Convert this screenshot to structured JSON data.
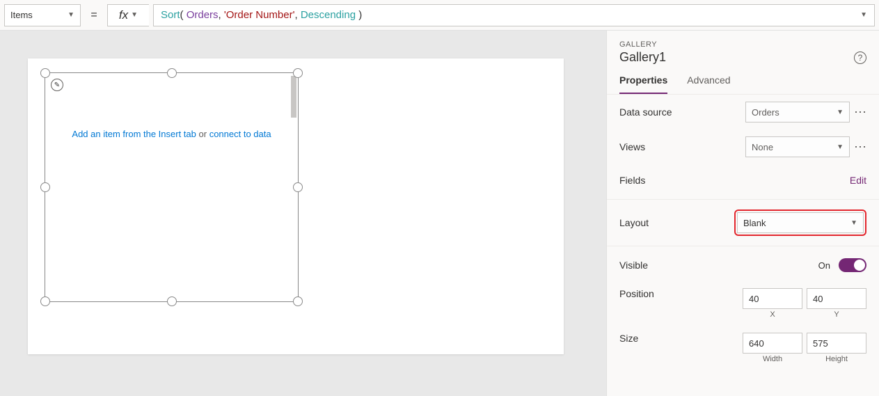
{
  "formulaBar": {
    "propertyName": "Items",
    "equals": "=",
    "fxLabel": "fx",
    "formula": {
      "fn": "Sort",
      "open": "( ",
      "table": "Orders",
      "sep1": ", ",
      "column": "'Order Number'",
      "sep2": ", ",
      "enum": "Descending",
      "close": " )"
    }
  },
  "canvas": {
    "placeholderLink1": "Add an item from the Insert tab",
    "placeholderMiddle": " or ",
    "placeholderLink2": "connect to data"
  },
  "panel": {
    "typeLabel": "GALLERY",
    "controlName": "Gallery1",
    "tabs": {
      "properties": "Properties",
      "advanced": "Advanced"
    },
    "dataSource": {
      "label": "Data source",
      "value": "Orders"
    },
    "views": {
      "label": "Views",
      "value": "None"
    },
    "fields": {
      "label": "Fields",
      "action": "Edit"
    },
    "layout": {
      "label": "Layout",
      "value": "Blank"
    },
    "visible": {
      "label": "Visible",
      "state": "On"
    },
    "position": {
      "label": "Position",
      "x": "40",
      "y": "40",
      "xLabel": "X",
      "yLabel": "Y"
    },
    "size": {
      "label": "Size",
      "w": "640",
      "h": "575",
      "wLabel": "Width",
      "hLabel": "Height"
    }
  }
}
